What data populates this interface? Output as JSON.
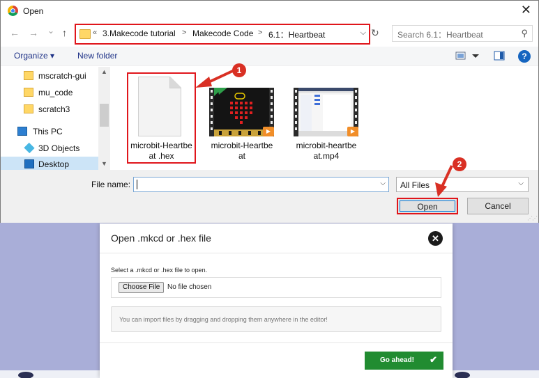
{
  "dialog": {
    "title": "Open",
    "nav": {
      "back": "←",
      "forward": "→",
      "recent": "⌄",
      "up": "↑",
      "refresh": "↻"
    },
    "breadcrumb": {
      "overflow": "«",
      "segments": [
        "3.Makecode tutorial",
        "Makecode Code",
        "6.1：Heartbeat"
      ],
      "separator": ">"
    },
    "search_placeholder": "Search 6.1：Heartbeat",
    "toolbar": {
      "organize": "Organize ▾",
      "new_folder": "New folder",
      "help": "?"
    },
    "sidebar": {
      "items": [
        {
          "label": "mscratch-gui",
          "icon": "folder-icon"
        },
        {
          "label": "mu_code",
          "icon": "folder-icon"
        },
        {
          "label": "scratch3",
          "icon": "folder-icon"
        },
        {
          "label": "This PC",
          "icon": "computer-icon"
        },
        {
          "label": "3D Objects",
          "icon": "cube-icon"
        },
        {
          "label": "Desktop",
          "icon": "desktop-icon"
        }
      ]
    },
    "files": [
      {
        "label_line1": "microbit-Heartbe",
        "label_line2": "at .hex",
        "icon": "document-icon"
      },
      {
        "label_line1": "microbit-Heartbe",
        "label_line2": "at",
        "icon": "video-icon"
      },
      {
        "label_line1": "microbit-heartbe",
        "label_line2": "at.mp4",
        "icon": "video-icon"
      }
    ],
    "file_name_label": "File name:",
    "file_name_value": "",
    "file_type": "All Files",
    "open_button": "Open",
    "cancel_button": "Cancel"
  },
  "annotations": {
    "step1": "1",
    "step2": "2",
    "color": "#d93024"
  },
  "modal": {
    "title": "Open .mkcd or .hex file",
    "description": "Select a .mkcd or .hex file to open.",
    "choose_file": "Choose File",
    "no_file": "No file chosen",
    "drop_hint": "You can import files by dragging and dropping them anywhere in the editor!",
    "go_button": "Go ahead!",
    "accent": "#218c31"
  }
}
